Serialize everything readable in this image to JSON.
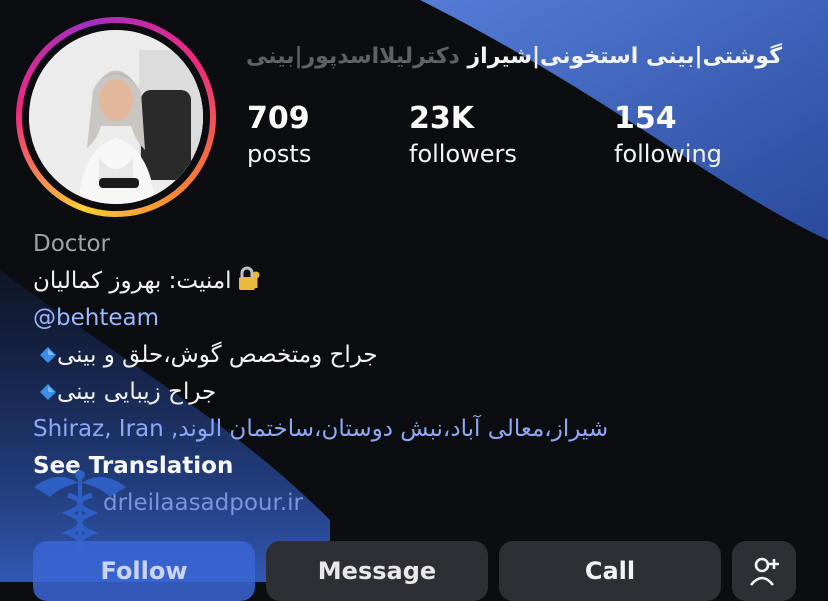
{
  "profile": {
    "name_faded": "دکترلیلااسدپور|بینی",
    "name_main": "گوشتی|بینی استخونی|شیراز",
    "stats": [
      {
        "value": "709",
        "label": "posts"
      },
      {
        "value": "23K",
        "label": "followers"
      },
      {
        "value": "154",
        "label": "following"
      }
    ]
  },
  "bio": {
    "category": "Doctor",
    "security_line": "امنیت: بهروز کمالیان",
    "mention": "@behteam",
    "line1": "جراح ومتخصص گوش،حلق و بینی",
    "line2": "جراح زیبایی بینی",
    "location_fa": "شیراز،معالی آباد،نبش دوستان،ساختمان الوند,",
    "location_en": "Shiraz, Iran",
    "see_translation": "See Translation",
    "website": "drleilaasadpour.ir"
  },
  "buttons": {
    "follow": "Follow",
    "message": "Message",
    "call": "Call"
  },
  "icons": {
    "lock": "lock-with-key-icon",
    "diamond": "blue-diamond-icon",
    "add_person": "add-person-icon",
    "caduceus": "caduceus-icon",
    "link": "link-icon"
  },
  "colors": {
    "background": "#0c0d10",
    "accent_blue": "#3b62c4",
    "link": "#9db7ff"
  }
}
